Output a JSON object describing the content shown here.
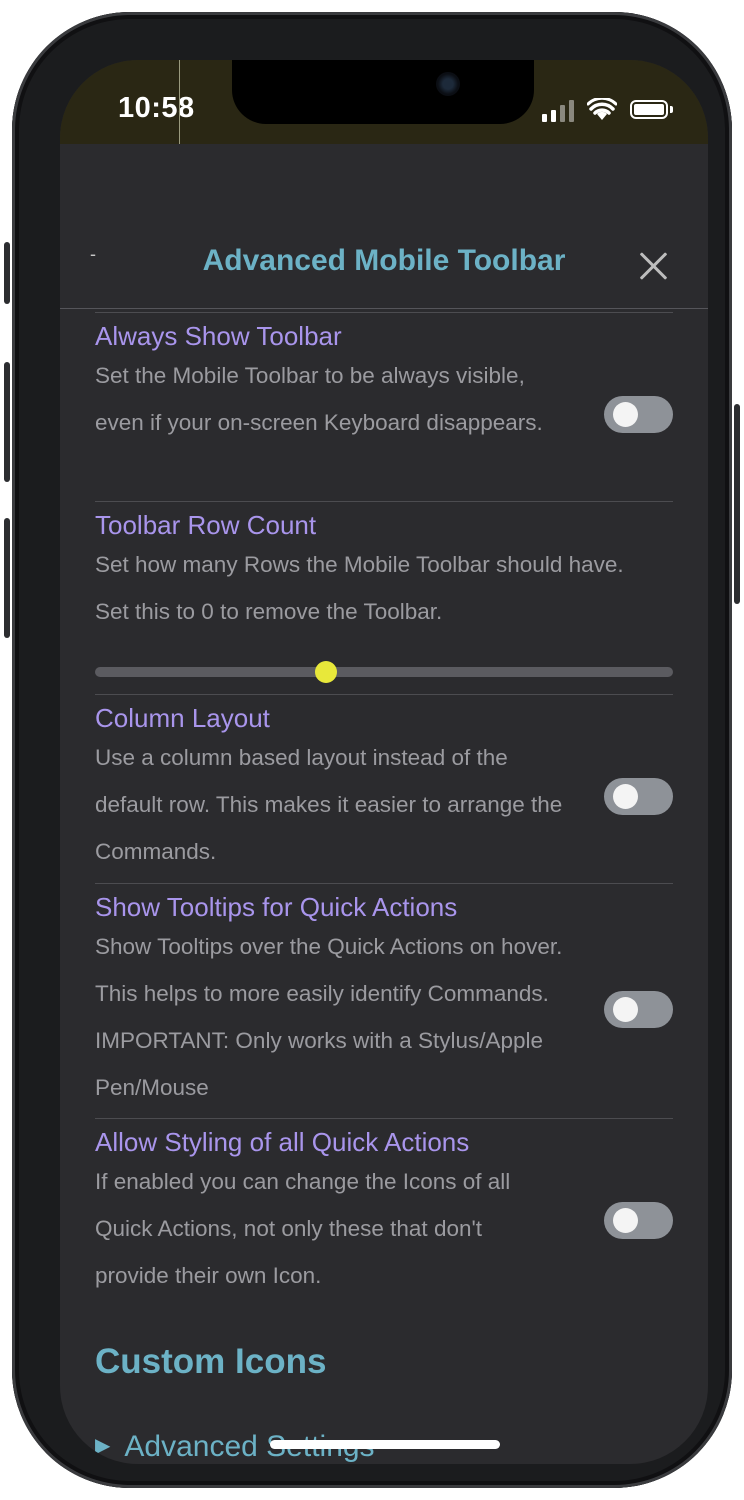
{
  "status_bar": {
    "time": "10:58"
  },
  "modal": {
    "dash": "-",
    "title": "Advanced Mobile Toolbar",
    "close_icon": "close-icon"
  },
  "settings": [
    {
      "name": "Always Show Toolbar",
      "description": "Set the Mobile Toolbar to be always visible, even if your on-screen Keyboard disappears.",
      "control": "toggle",
      "enabled": false
    },
    {
      "name": "Toolbar Row Count",
      "description": "Set how many Rows the Mobile Toolbar should have. Set this to 0 to remove the Toolbar.",
      "control": "slider",
      "slider_fraction": 0.4
    },
    {
      "name": "Column Layout",
      "description": "Use a column based layout instead of the default row. This makes it easier to arrange the Commands.",
      "control": "toggle",
      "enabled": false
    },
    {
      "name": "Show Tooltips for Quick Actions",
      "description": "Show Tooltips over the Quick Actions on hover. This helps to more easily identify Commands. IMPORTANT: Only works with a Stylus/Apple Pen/Mouse",
      "control": "toggle",
      "enabled": false
    },
    {
      "name": "Allow Styling of all Quick Actions",
      "description": "If enabled you can change the Icons of all Quick Actions, not only these that don't provide their own Icon.",
      "control": "toggle",
      "enabled": false
    }
  ],
  "custom_icons": {
    "title": "Custom Icons",
    "advanced_settings": "Advanced Settings"
  },
  "colors": {
    "accent": "#6cb2c6",
    "setting_name": "#a995ec",
    "slider_thumb": "#e8e83a"
  }
}
